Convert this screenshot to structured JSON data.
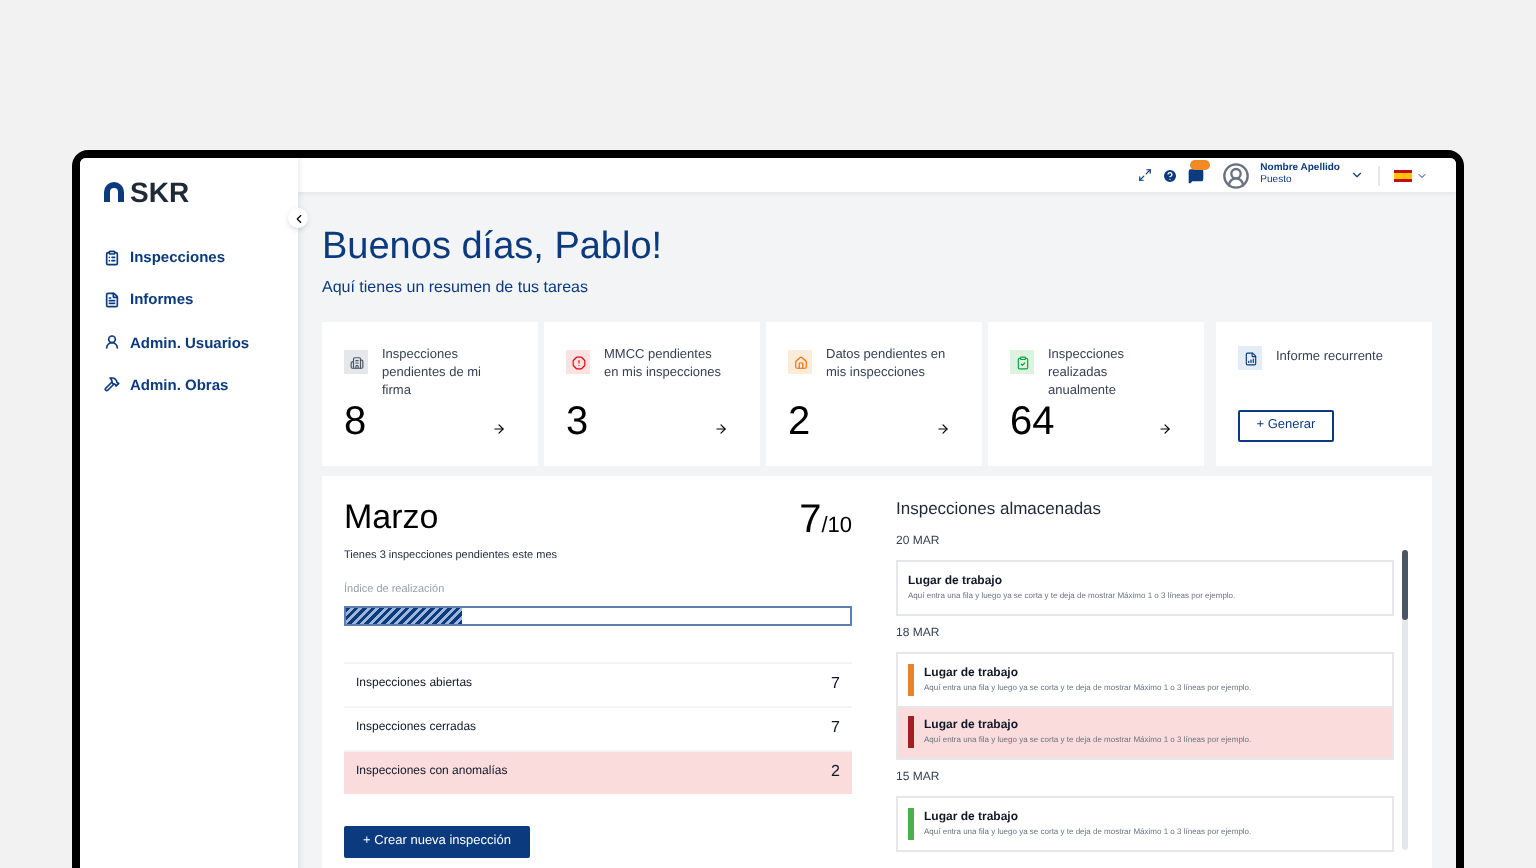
{
  "sidebar": {
    "logo": "SKR",
    "items": [
      {
        "label": "Inspecciones"
      },
      {
        "label": "Informes"
      },
      {
        "label": "Admin. Usuarios"
      },
      {
        "label": "Admin. Obras"
      }
    ]
  },
  "topbar": {
    "user": {
      "name": "Nombre Apellido",
      "role": "Puesto"
    }
  },
  "greeting": {
    "title": "Buenos días, Pablo!",
    "subtitle": "Aquí tienes un resumen de tus tareas"
  },
  "cards": [
    {
      "label": "Inspecciones pendientes de mi firma",
      "value": "8",
      "color": "#e5e7eb"
    },
    {
      "label": "MMCC pendientes en mis inspecciones",
      "value": "3",
      "color": "#fde2e2"
    },
    {
      "label": "Datos pendientes en mis inspecciones",
      "value": "2",
      "color": "#fdecd9"
    },
    {
      "label": "Inspecciones realizadas anualmente",
      "value": "64",
      "color": "#dcf3e0"
    }
  ],
  "report_card": {
    "label": "Informe recurrente",
    "button": "+ Generar"
  },
  "month": {
    "title": "Marzo",
    "score": "7",
    "total": "/10",
    "note": "Tienes 3 inspecciones pendientes este mes",
    "progress_label": "Índice de realización",
    "level": 0.23,
    "rows": [
      {
        "label": "Inspecciones abiertas",
        "value": "7",
        "highlighted": false
      },
      {
        "label": "Inspecciones cerradas",
        "value": "7",
        "highlighted": false
      },
      {
        "label": "Inspecciones con anomalías",
        "value": "2",
        "highlighted": true
      }
    ],
    "button": "+ Crear nueva inspección"
  },
  "stored": {
    "title": "Inspecciones almacenadas",
    "groups": [
      {
        "date": "20 MAR",
        "items": [
          {
            "title": "Lugar de trabajo",
            "text": "Aquí entra una fila y luego ya se corta y te deja de mostrar Máximo 1 o 3 líneas por ejemplo.",
            "highlighted": false
          }
        ]
      },
      {
        "date": "18 MAR",
        "items": [
          {
            "title": "Lugar de trabajo",
            "text": "Aquí entra una fila y luego ya se corta y te deja de mostrar Máximo 1 o 3 líneas por ejemplo.",
            "color": "#e8832a",
            "highlighted": false
          },
          {
            "title": "Lugar de trabajo",
            "text": "Aquí entra una fila y luego ya se corta y te deja de mostrar Máximo 1 o 3 líneas por ejemplo.",
            "color": "#a31d24",
            "highlighted": true
          }
        ]
      },
      {
        "date": "15 MAR",
        "items": [
          {
            "title": "Lugar de trabajo",
            "text": "Aquí entra una fila y luego ya se corta y te deja de mostrar Máximo 1 o 3 líneas por ejemplo.",
            "color": "#4caf50",
            "highlighted": false
          }
        ]
      }
    ]
  }
}
